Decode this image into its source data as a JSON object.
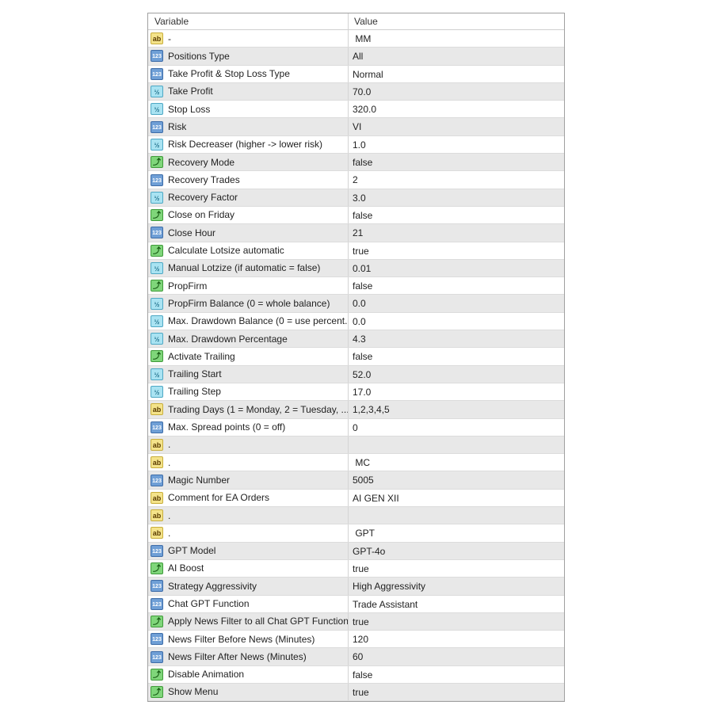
{
  "header": {
    "variable": "Variable",
    "value": "Value"
  },
  "type_icons": {
    "s": "ab",
    "i": "123",
    "d": "½",
    "b": "⤴"
  },
  "rows": [
    {
      "type": "s",
      "name": "-",
      "value": " MM"
    },
    {
      "type": "i",
      "name": "Positions Type",
      "value": "All"
    },
    {
      "type": "i",
      "name": "Take Profit & Stop Loss Type",
      "value": "Normal"
    },
    {
      "type": "d",
      "name": "Take Profit",
      "value": "70.0"
    },
    {
      "type": "d",
      "name": "Stop Loss",
      "value": "320.0"
    },
    {
      "type": "i",
      "name": "Risk",
      "value": "VI"
    },
    {
      "type": "d",
      "name": "Risk Decreaser (higher -> lower risk)",
      "value": "1.0"
    },
    {
      "type": "b",
      "name": "Recovery Mode",
      "value": "false"
    },
    {
      "type": "i",
      "name": "Recovery Trades",
      "value": "2"
    },
    {
      "type": "d",
      "name": "Recovery Factor",
      "value": "3.0"
    },
    {
      "type": "b",
      "name": "Close on Friday",
      "value": "false"
    },
    {
      "type": "i",
      "name": "Close Hour",
      "value": "21"
    },
    {
      "type": "b",
      "name": "Calculate Lotsize automatic",
      "value": "true"
    },
    {
      "type": "d",
      "name": "Manual Lotzize (if automatic = false)",
      "value": "0.01"
    },
    {
      "type": "b",
      "name": "PropFirm",
      "value": "false"
    },
    {
      "type": "d",
      "name": "PropFirm Balance (0 = whole balance)",
      "value": "0.0"
    },
    {
      "type": "d",
      "name": "Max. Drawdown Balance (0 = use percent...",
      "value": "0.0"
    },
    {
      "type": "d",
      "name": "Max. Drawdown Percentage",
      "value": "4.3"
    },
    {
      "type": "b",
      "name": "Activate Trailing",
      "value": "false"
    },
    {
      "type": "d",
      "name": "Trailing Start",
      "value": "52.0"
    },
    {
      "type": "d",
      "name": "Trailing Step",
      "value": "17.0"
    },
    {
      "type": "s",
      "name": "Trading Days (1 = Monday, 2 = Tuesday, ...)",
      "value": "1,2,3,4,5"
    },
    {
      "type": "i",
      "name": "Max. Spread points (0 = off)",
      "value": "0"
    },
    {
      "type": "s",
      "name": ".",
      "value": ""
    },
    {
      "type": "s",
      "name": ".",
      "value": " MC"
    },
    {
      "type": "i",
      "name": "Magic Number",
      "value": "5005"
    },
    {
      "type": "s",
      "name": "Comment for EA Orders",
      "value": "AI GEN XII"
    },
    {
      "type": "s",
      "name": ".",
      "value": ""
    },
    {
      "type": "s",
      "name": ".",
      "value": " GPT"
    },
    {
      "type": "i",
      "name": "GPT Model",
      "value": "GPT-4o"
    },
    {
      "type": "b",
      "name": "AI Boost",
      "value": "true"
    },
    {
      "type": "i",
      "name": "Strategy Aggressivity",
      "value": "High Aggressivity"
    },
    {
      "type": "i",
      "name": "Chat GPT Function",
      "value": "Trade Assistant"
    },
    {
      "type": "b",
      "name": "Apply News Filter to all Chat GPT Function",
      "value": "true"
    },
    {
      "type": "i",
      "name": "News Filter Before News (Minutes)",
      "value": "120"
    },
    {
      "type": "i",
      "name": "News Filter After News (Minutes)",
      "value": "60"
    },
    {
      "type": "b",
      "name": "Disable Animation",
      "value": "false"
    },
    {
      "type": "b",
      "name": "Show Menu",
      "value": "true"
    }
  ]
}
